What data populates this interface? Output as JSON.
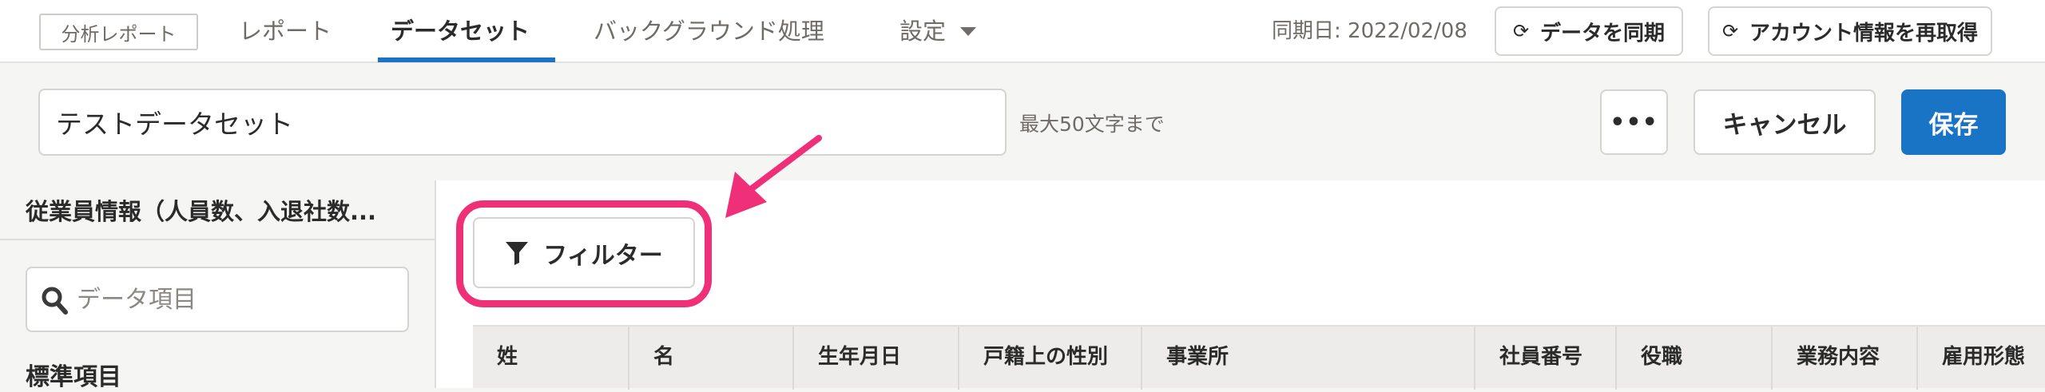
{
  "header": {
    "badge": "分析レポート",
    "tabs": [
      {
        "label": "レポート"
      },
      {
        "label": "データセット"
      },
      {
        "label": "バックグラウンド処理"
      },
      {
        "label": "設定"
      }
    ],
    "sync_date": "同期日: 2022/02/08",
    "sync_button": "データを同期",
    "refresh_account_button": "アカウント情報を再取得"
  },
  "dataset": {
    "name_value": "テストデータセット",
    "name_hint": "最大50文字まで",
    "more_button": "•••",
    "cancel_button": "キャンセル",
    "save_button": "保存"
  },
  "sidebar": {
    "category_title": "従業員情報（人員数、入退社数...",
    "search_placeholder": "データ項目",
    "section_title": "標準項目"
  },
  "main": {
    "filter_button": "フィルター",
    "columns": [
      "姓",
      "名",
      "生年月日",
      "戸籍上の性別",
      "事業所",
      "社員番号",
      "役職",
      "業務内容",
      "雇用形態"
    ]
  },
  "colors": {
    "accent": "#1a74c6",
    "highlight": "#ef2f78"
  }
}
